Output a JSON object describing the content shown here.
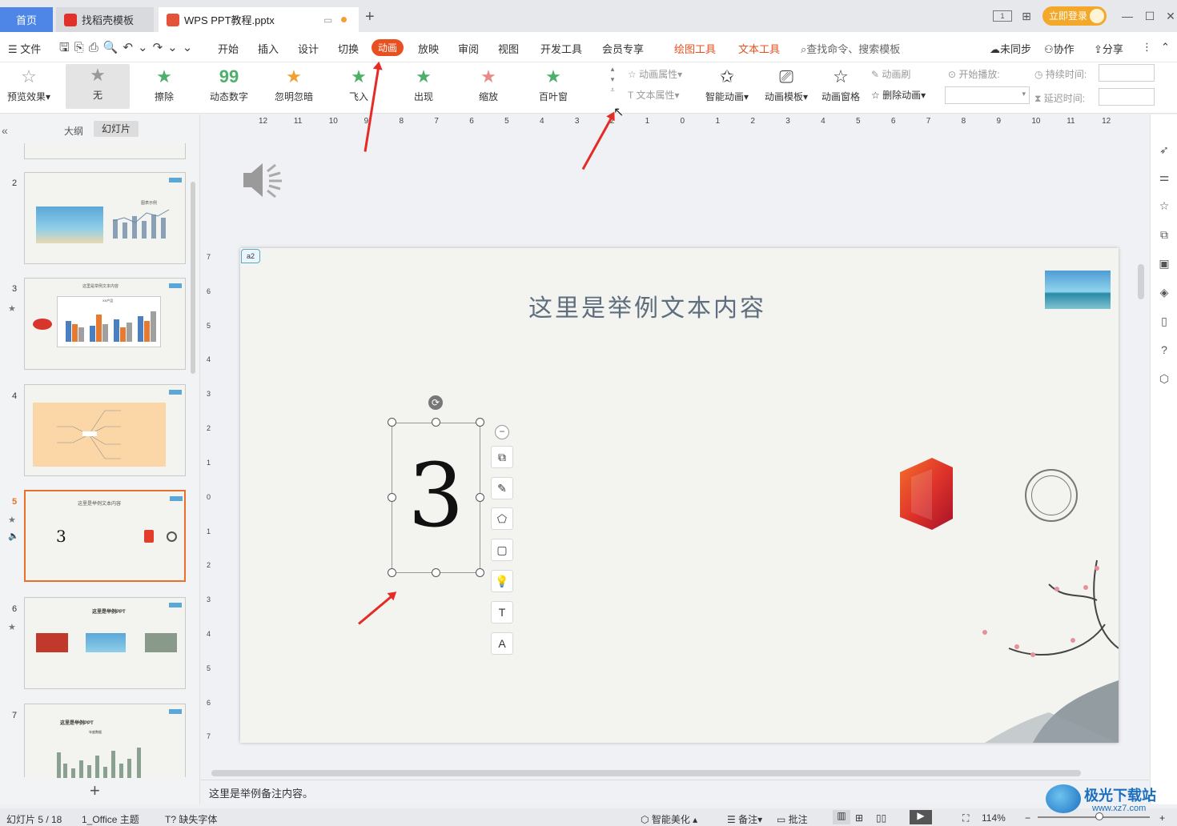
{
  "tabs": {
    "home": "首页",
    "docer": "找稻壳模板",
    "document": "WPS PPT教程.pptx",
    "new_tab": "+"
  },
  "window": {
    "login": "立即登录",
    "minimize": "—",
    "maximize": "☐",
    "close": "✕"
  },
  "menu": {
    "file": "文件",
    "items": [
      "开始",
      "插入",
      "设计",
      "切换",
      "动画",
      "放映",
      "审阅",
      "视图",
      "开发工具",
      "会员专享"
    ],
    "tool_tabs": [
      "绘图工具",
      "文本工具"
    ],
    "search": "查找命令、搜索模板",
    "right": [
      "未同步",
      "协作",
      "分享"
    ]
  },
  "ribbon": {
    "preview": "预览效果",
    "effects": [
      "无",
      "擦除",
      "动态数字",
      "忽明忽暗",
      "飞入",
      "出现",
      "缩放",
      "百叶窗"
    ],
    "anim_props": "动画属性",
    "text_props": "文本属性",
    "smart_anim": "智能动画",
    "anim_template": "动画模板",
    "anim_pane": "动画窗格",
    "anim_brush": "动画刷",
    "delete_anim": "删除动画",
    "start_play": "开始播放:",
    "duration": "持续时间:",
    "delay": "延迟时间:"
  },
  "left_panel": {
    "tab_outline": "大纲",
    "tab_slides": "幻灯片",
    "slide_numbers": [
      "2",
      "3",
      "4",
      "5",
      "6",
      "7"
    ],
    "thumb_titles": {
      "s2": "图表示例",
      "s3": "这里是举例文本内容",
      "s3_chart": "XX产品",
      "s5": "这里是举例文本内容",
      "s5_num": "3",
      "s6": "这里是举例PPT",
      "s7": "这里是举例PPT",
      "s7_chart": "年度数据"
    },
    "add": "+"
  },
  "slide": {
    "title": "这里是举例文本内容",
    "big_number": "3",
    "comment_tag": "a2"
  },
  "ruler": {
    "h_ticks": [
      "12",
      "11",
      "10",
      "9",
      "8",
      "7",
      "6",
      "5",
      "4",
      "3",
      "2",
      "1",
      "0",
      "1",
      "2",
      "3",
      "4",
      "5",
      "6",
      "7",
      "8",
      "9",
      "10",
      "11",
      "12"
    ],
    "v_ticks": [
      "7",
      "6",
      "5",
      "4",
      "3",
      "2",
      "1",
      "0",
      "1",
      "2",
      "3",
      "4",
      "5",
      "6",
      "7"
    ]
  },
  "notes": {
    "text": "这里是举例备注内容。"
  },
  "status": {
    "slide_pos": "幻灯片 5 / 18",
    "theme": "1_Office 主题",
    "missing_font": "缺失字体",
    "beautify": "智能美化",
    "notes": "备注",
    "comment": "批注",
    "zoom": "114%",
    "watermark": "极光下载站",
    "watermark_url": "www.xz7.com"
  }
}
